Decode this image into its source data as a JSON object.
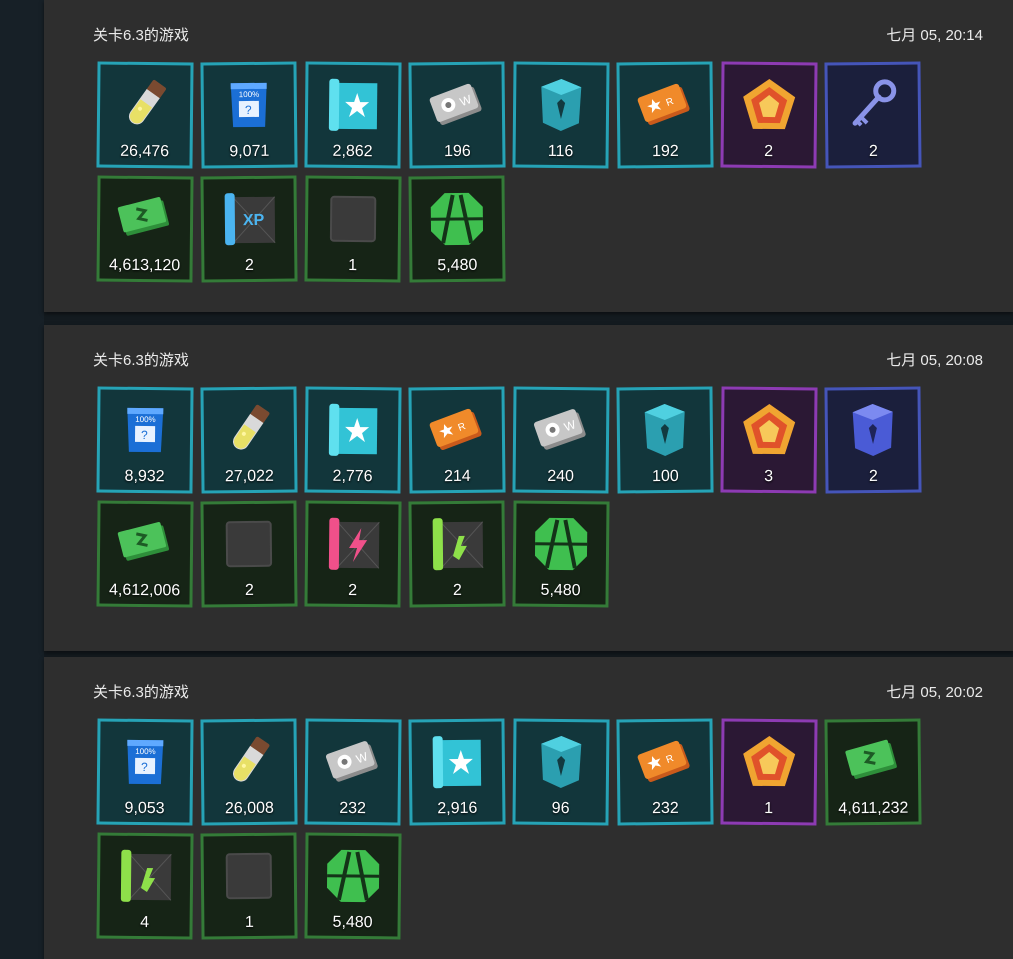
{
  "entries": [
    {
      "title": "关卡6.3的游戏",
      "time": "七月 05, 20:14",
      "rows": [
        [
          {
            "icon": "potion-icon",
            "count": "26,476",
            "rarity": "teal"
          },
          {
            "icon": "mystery-pack-icon",
            "count": "9,071",
            "rarity": "teal"
          },
          {
            "icon": "star-blueprint-icon",
            "count": "2,862",
            "rarity": "teal"
          },
          {
            "icon": "silver-ticket-icon",
            "count": "196",
            "rarity": "teal"
          },
          {
            "icon": "teal-crate-icon",
            "count": "116",
            "rarity": "teal"
          },
          {
            "icon": "orange-ticket-icon",
            "count": "192",
            "rarity": "teal"
          },
          {
            "icon": "pentagon-token-icon",
            "count": "2",
            "rarity": "purple"
          },
          {
            "icon": "key-icon",
            "count": "2",
            "rarity": "blue"
          }
        ],
        [
          {
            "icon": "cash-icon",
            "count": "4,613,120",
            "rarity": "green"
          },
          {
            "icon": "xp-blueprint-icon",
            "count": "2",
            "rarity": "green"
          },
          {
            "icon": "blank-card-icon",
            "count": "1",
            "rarity": "green"
          },
          {
            "icon": "green-emblem-icon",
            "count": "5,480",
            "rarity": "green"
          }
        ]
      ]
    },
    {
      "title": "关卡6.3的游戏",
      "time": "七月 05, 20:08",
      "rows": [
        [
          {
            "icon": "mystery-pack-icon",
            "count": "8,932",
            "rarity": "teal"
          },
          {
            "icon": "potion-icon",
            "count": "27,022",
            "rarity": "teal"
          },
          {
            "icon": "star-blueprint-icon",
            "count": "2,776",
            "rarity": "teal"
          },
          {
            "icon": "orange-ticket-icon",
            "count": "214",
            "rarity": "teal"
          },
          {
            "icon": "silver-ticket-icon",
            "count": "240",
            "rarity": "teal"
          },
          {
            "icon": "teal-crate-icon",
            "count": "100",
            "rarity": "teal"
          },
          {
            "icon": "pentagon-token-icon",
            "count": "3",
            "rarity": "purple"
          },
          {
            "icon": "blue-crate-icon",
            "count": "2",
            "rarity": "blue"
          }
        ],
        [
          {
            "icon": "cash-icon",
            "count": "4,612,006",
            "rarity": "green"
          },
          {
            "icon": "blank-card-icon",
            "count": "2",
            "rarity": "green"
          },
          {
            "icon": "pink-bolt-blueprint-icon",
            "count": "2",
            "rarity": "green"
          },
          {
            "icon": "green-blueprint-icon",
            "count": "2",
            "rarity": "green"
          },
          {
            "icon": "green-emblem-icon",
            "count": "5,480",
            "rarity": "green"
          }
        ]
      ]
    },
    {
      "title": "关卡6.3的游戏",
      "time": "七月 05, 20:02",
      "rows": [
        [
          {
            "icon": "mystery-pack-icon",
            "count": "9,053",
            "rarity": "teal"
          },
          {
            "icon": "potion-icon",
            "count": "26,008",
            "rarity": "teal"
          },
          {
            "icon": "silver-ticket-icon",
            "count": "232",
            "rarity": "teal"
          },
          {
            "icon": "star-blueprint-icon",
            "count": "2,916",
            "rarity": "teal"
          },
          {
            "icon": "teal-crate-icon",
            "count": "96",
            "rarity": "teal"
          },
          {
            "icon": "orange-ticket-icon",
            "count": "232",
            "rarity": "teal"
          },
          {
            "icon": "pentagon-token-icon",
            "count": "1",
            "rarity": "purple"
          },
          {
            "icon": "cash-icon",
            "count": "4,611,232",
            "rarity": "green"
          }
        ],
        [
          {
            "icon": "green-blueprint-icon",
            "count": "4",
            "rarity": "green"
          },
          {
            "icon": "blank-card-icon",
            "count": "1",
            "rarity": "green"
          },
          {
            "icon": "green-emblem-icon",
            "count": "5,480",
            "rarity": "green"
          }
        ]
      ]
    }
  ],
  "colors": {
    "teal": "#26a3b6",
    "purple": "#8d3bb3",
    "blue": "#4555b9",
    "green": "#347b38"
  }
}
